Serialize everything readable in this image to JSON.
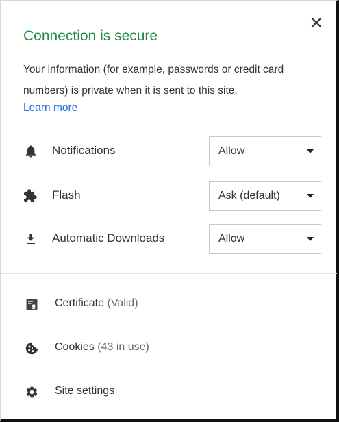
{
  "popup": {
    "title": "Connection is secure",
    "description": "Your information (for example, passwords or credit card numbers) is private when it is sent to this site.",
    "learn_more": "Learn more",
    "close_glyph": "×",
    "colors": {
      "title": "#1e8e3e",
      "link": "#1a73e8",
      "text": "#333333"
    }
  },
  "permissions": [
    {
      "icon": "bell-icon",
      "label": "Notifications",
      "value": "Allow"
    },
    {
      "icon": "puzzle-icon",
      "label": "Flash",
      "value": "Ask (default)"
    },
    {
      "icon": "download-icon",
      "label": "Automatic Downloads",
      "value": "Allow"
    }
  ],
  "links": [
    {
      "icon": "certificate-icon",
      "label": "Certificate",
      "sub": "(Valid)"
    },
    {
      "icon": "cookie-icon",
      "label": "Cookies",
      "sub": "(43 in use)"
    },
    {
      "icon": "gear-icon",
      "label": "Site settings",
      "sub": ""
    }
  ]
}
